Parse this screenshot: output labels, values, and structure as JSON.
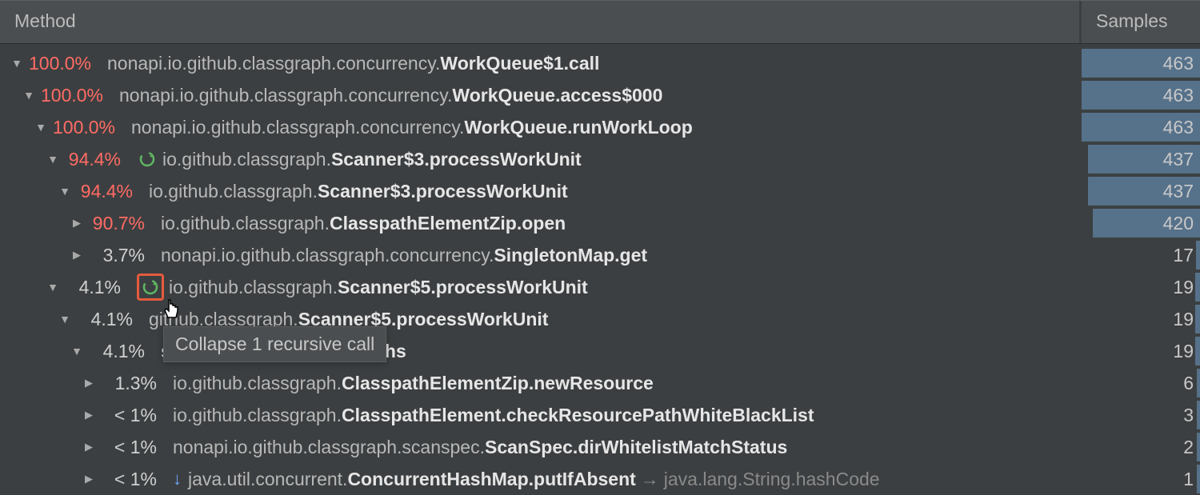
{
  "header": {
    "method": "Method",
    "samples": "Samples"
  },
  "tooltip": "Collapse 1 recursive call",
  "max_samples": 463,
  "rows": [
    {
      "indent": 12,
      "arrow": "down",
      "pct": "100.0%",
      "hot": true,
      "rec": false,
      "highlight": false,
      "down_arrow": false,
      "pkg": "nonapi.io.github.classgraph.concurrency.",
      "meth": "WorkQueue$1.call",
      "callee": "",
      "samples": "463",
      "bar": 463
    },
    {
      "indent": 27,
      "arrow": "down",
      "pct": "100.0%",
      "hot": true,
      "rec": false,
      "highlight": false,
      "down_arrow": false,
      "pkg": "nonapi.io.github.classgraph.concurrency.",
      "meth": "WorkQueue.access$000",
      "callee": "",
      "samples": "463",
      "bar": 463
    },
    {
      "indent": 42,
      "arrow": "down",
      "pct": "100.0%",
      "hot": true,
      "rec": false,
      "highlight": false,
      "down_arrow": false,
      "pkg": "nonapi.io.github.classgraph.concurrency.",
      "meth": "WorkQueue.runWorkLoop",
      "callee": "",
      "samples": "463",
      "bar": 463
    },
    {
      "indent": 57,
      "arrow": "down",
      "pct": "94.4%",
      "hot": true,
      "rec": true,
      "highlight": false,
      "down_arrow": false,
      "pkg": "io.github.classgraph.",
      "meth": "Scanner$3.processWorkUnit",
      "callee": "",
      "samples": "437",
      "bar": 437
    },
    {
      "indent": 72,
      "arrow": "down",
      "pct": "94.4%",
      "hot": true,
      "rec": false,
      "highlight": false,
      "down_arrow": false,
      "pkg": "io.github.classgraph.",
      "meth": "Scanner$3.processWorkUnit",
      "callee": "",
      "samples": "437",
      "bar": 437
    },
    {
      "indent": 87,
      "arrow": "right",
      "pct": "90.7%",
      "hot": true,
      "rec": false,
      "highlight": false,
      "down_arrow": false,
      "pkg": "io.github.classgraph.",
      "meth": "ClasspathElementZip.open",
      "callee": "",
      "samples": "420",
      "bar": 420
    },
    {
      "indent": 87,
      "arrow": "right",
      "pct": "3.7%",
      "hot": false,
      "rec": false,
      "highlight": false,
      "down_arrow": false,
      "pkg": "nonapi.io.github.classgraph.concurrency.",
      "meth": "SingletonMap.get",
      "callee": "",
      "samples": "17",
      "bar": 17
    },
    {
      "indent": 57,
      "arrow": "down",
      "pct": "4.1%",
      "hot": false,
      "rec": true,
      "highlight": true,
      "down_arrow": false,
      "pkg": "io.github.classgraph.",
      "meth": "Scanner$5.processWorkUnit",
      "callee": "",
      "samples": "19",
      "bar": 19
    },
    {
      "indent": 72,
      "arrow": "down",
      "pct": "4.1%",
      "hot": false,
      "rec": false,
      "highlight": false,
      "down_arrow": false,
      "pkg": "github.classgraph.",
      "meth": "Scanner$5.processWorkUnit",
      "callee": "",
      "samples": "19",
      "bar": 19
    },
    {
      "indent": 87,
      "arrow": "down",
      "pct": "4.1%",
      "hot": false,
      "rec": false,
      "highlight": false,
      "down_arrow": false,
      "pkg": "",
      "meth": "spathElementZip.scanPaths",
      "callee": "",
      "samples": "19",
      "bar": 19
    },
    {
      "indent": 102,
      "arrow": "right",
      "pct": "1.3%",
      "hot": false,
      "rec": false,
      "highlight": false,
      "down_arrow": false,
      "pkg": "io.github.classgraph.",
      "meth": "ClasspathElementZip.newResource",
      "callee": "",
      "samples": "6",
      "bar": 6
    },
    {
      "indent": 102,
      "arrow": "right",
      "pct": "< 1%",
      "hot": false,
      "rec": false,
      "highlight": false,
      "down_arrow": false,
      "pkg": "io.github.classgraph.",
      "meth": "ClasspathElement.checkResourcePathWhiteBlackList",
      "callee": "",
      "samples": "3",
      "bar": 3
    },
    {
      "indent": 102,
      "arrow": "right",
      "pct": "< 1%",
      "hot": false,
      "rec": false,
      "highlight": false,
      "down_arrow": false,
      "pkg": "nonapi.io.github.classgraph.scanspec.",
      "meth": "ScanSpec.dirWhitelistMatchStatus",
      "callee": "",
      "samples": "2",
      "bar": 2
    },
    {
      "indent": 102,
      "arrow": "right",
      "pct": "< 1%",
      "hot": false,
      "rec": false,
      "highlight": false,
      "down_arrow": true,
      "pkg": "java.util.concurrent.",
      "meth": "ConcurrentHashMap.putIfAbsent",
      "callee": "java.lang.String.hashCode",
      "samples": "1",
      "bar": 1
    }
  ]
}
